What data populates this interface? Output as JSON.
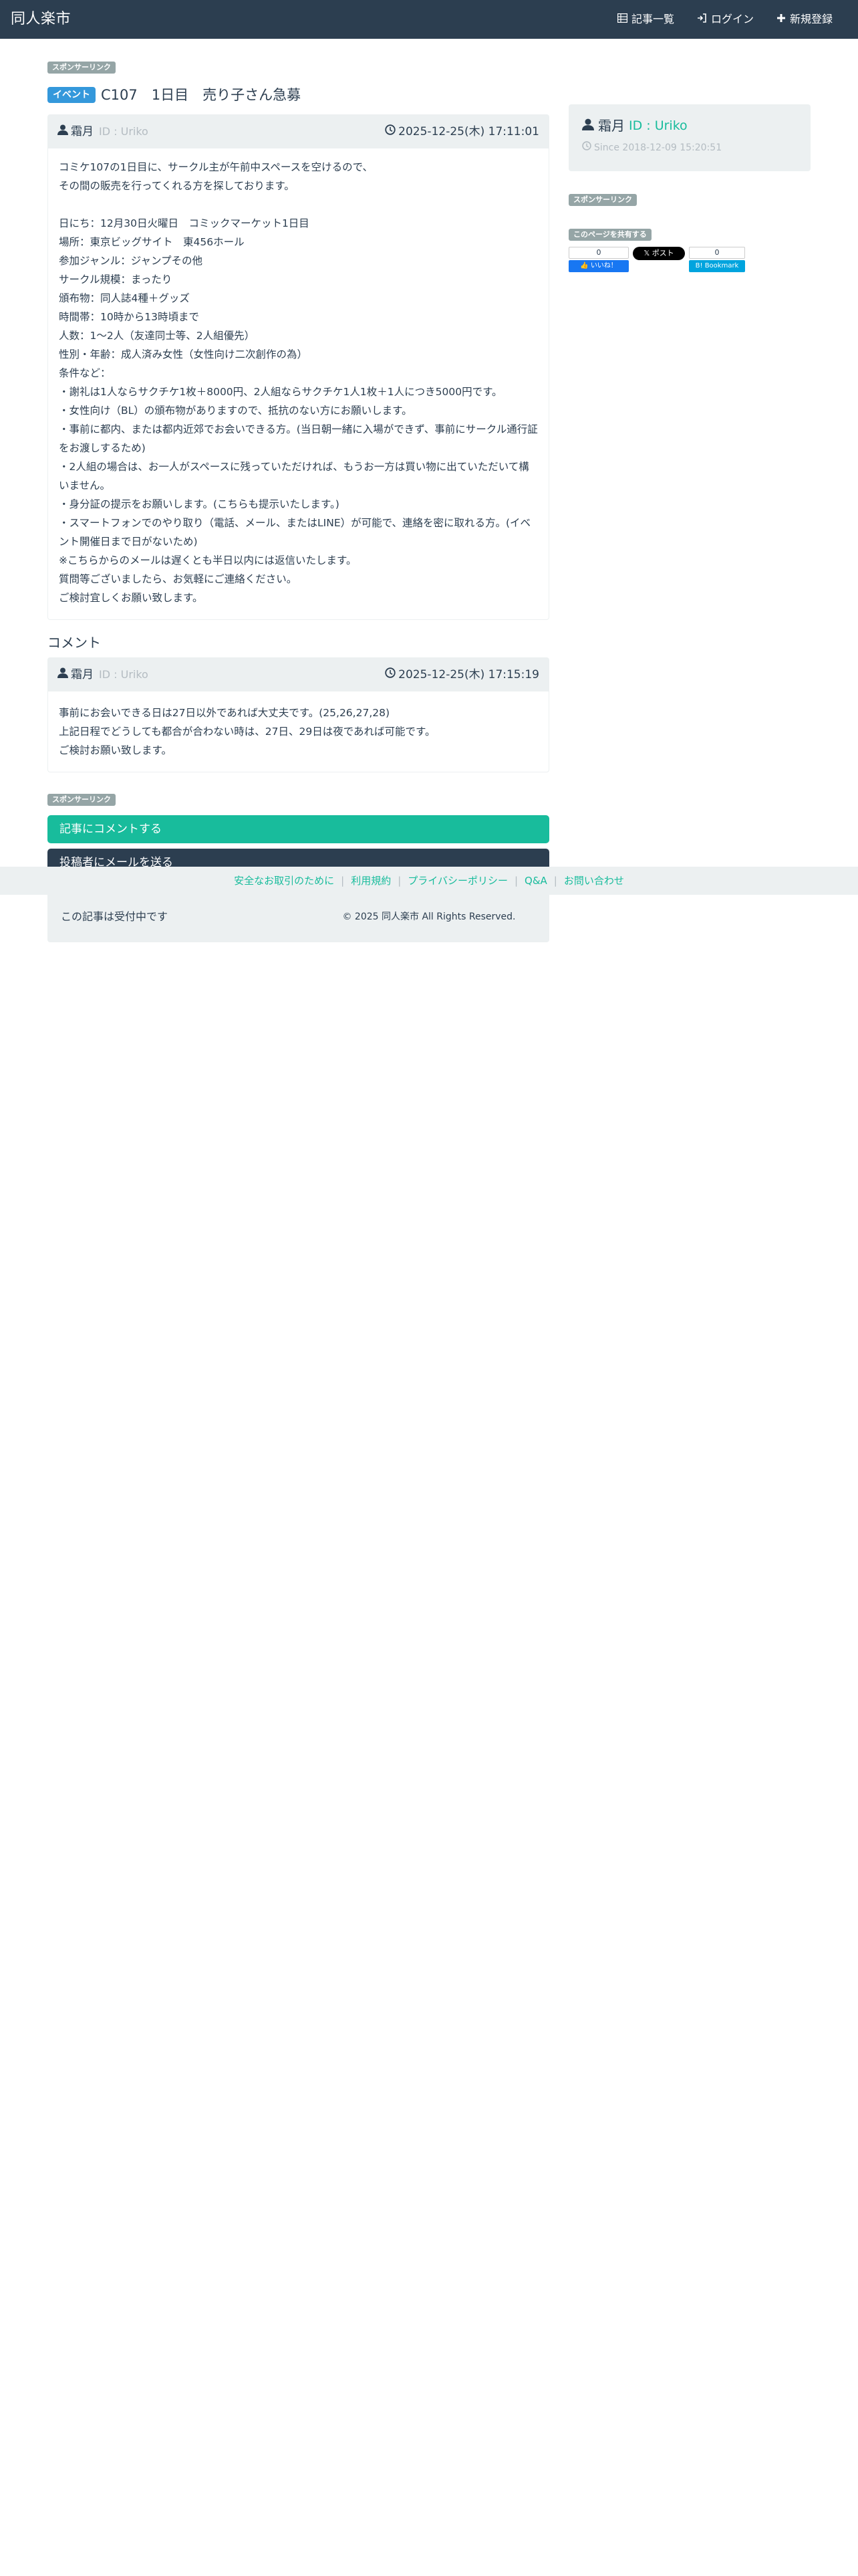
{
  "navbar": {
    "brand": "同人楽市",
    "links": [
      {
        "icon": "list-icon",
        "label": "記事一覧"
      },
      {
        "icon": "login-icon",
        "label": "ログイン"
      },
      {
        "icon": "plus-icon",
        "label": "新規登録"
      }
    ]
  },
  "sponsor_label": "スポンサーリンク",
  "post": {
    "category": "イベント",
    "title": "C107　1日目　売り子さん急募",
    "author_name": "霜月",
    "author_id": "ID : Uriko",
    "date": "2025-12-25(木) 17:11:01",
    "body_lines": [
      "コミケ107の1日目に、サークル主が午前中スペースを空けるので、",
      "その間の販売を行ってくれる方を探しております。",
      "",
      "日にち：12月30日火曜日　コミックマーケット1日目",
      "場所：東京ビッグサイト　東456ホール",
      "参加ジャンル：ジャンプその他",
      "サークル規模：まったり",
      "頒布物：同人誌4種＋グッズ",
      "時間帯：10時から13時頃まで",
      "人数：1〜2人（友達同士等、2人組優先）",
      "性別・年齢：成人済み女性（女性向け二次創作の為）",
      "条件など：",
      "・謝礼は1人ならサクチケ1枚＋8000円、2人組ならサクチケ1人1枚＋1人につき5000円です。",
      "・女性向け（BL）の頒布物がありますので、抵抗のない方にお願いします。",
      "・事前に都内、または都内近郊でお会いできる方。(当日朝一緒に入場ができず、事前にサークル通行証をお渡しするため)",
      "・2人組の場合は、お一人がスペースに残っていただければ、もうお一方は買い物に出ていただいて構いません。",
      "・身分証の提示をお願いします。(こちらも提示いたします。)",
      "・スマートフォンでのやり取り（電話、メール、またはLINE）が可能で、連絡を密に取れる方。(イベント開催日まで日がないため)",
      "※こちらからのメールは遅くとも半日以内には返信いたします。",
      "質問等ございましたら、お気軽にご連絡ください。",
      "ご検討宜しくお願い致します。"
    ]
  },
  "comments_title": "コメント",
  "comment": {
    "author_name": "霜月",
    "author_id": "ID : Uriko",
    "date": "2025-12-25(木) 17:15:19",
    "body_lines": [
      "事前にお会いできる日は27日以外であれば大丈夫です。(25,26,27,28)",
      "上記日程でどうしても都合が合わない時は、27日、29日は夜であれば可能です。",
      "ご検討お願い致します。"
    ]
  },
  "buttons": {
    "comment": "記事にコメントする",
    "mail": "投稿者にメールを送る"
  },
  "status_text": "この記事は受付中です",
  "profile": {
    "name": "霜月",
    "id": "ID : Uriko",
    "since": "Since 2018-12-09 15:20:51"
  },
  "share": {
    "label": "このページを共有する",
    "fb_count": "0",
    "fb_label": "いいね！",
    "x_label": "ポスト",
    "hatena_count": "0",
    "hatena_label": "Bookmark"
  },
  "footer": {
    "links": [
      "安全なお取引のために",
      "利用規約",
      "プライバシーポリシー",
      "Q&A",
      "お問い合わせ"
    ],
    "copyright": "© 2025 同人楽市 All Rights Reserved."
  },
  "colors": {
    "navbar": "#2c3e50",
    "accent_green": "#18bc9c",
    "event_blue": "#3498db",
    "panel_bg": "#ecf0f1"
  }
}
